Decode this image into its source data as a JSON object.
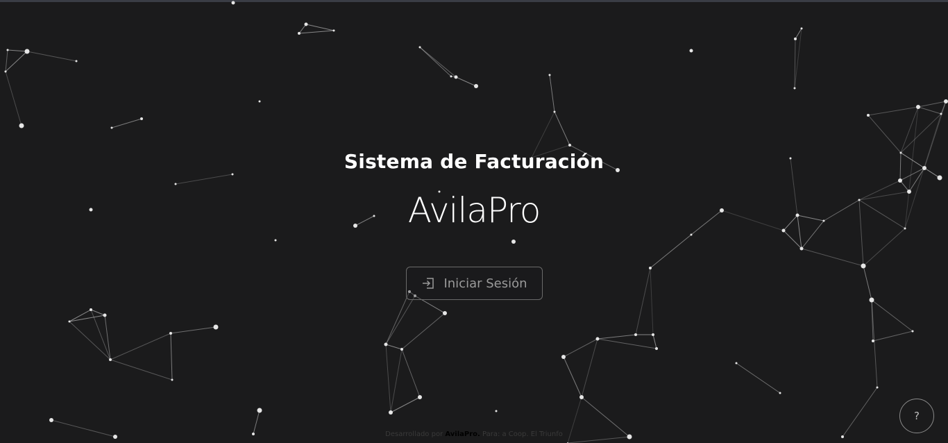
{
  "hero": {
    "subtitle": "Sistema de Facturación",
    "brand": "AvilaPro"
  },
  "login_button": {
    "label": "Iniciar Sesión",
    "icon": "login-enter-icon"
  },
  "help_button": {
    "label": "?"
  },
  "footer": {
    "prefix": "Desarrollado por",
    "brand": "AvilaPro.",
    "suffix": "Para: a Coop. El Triunfo"
  },
  "colors": {
    "background": "#1b1b1c",
    "node": "#e6e6e6",
    "edge": "#bdbdbd",
    "text": "#ffffff",
    "button_text": "#9a9a9a"
  }
}
